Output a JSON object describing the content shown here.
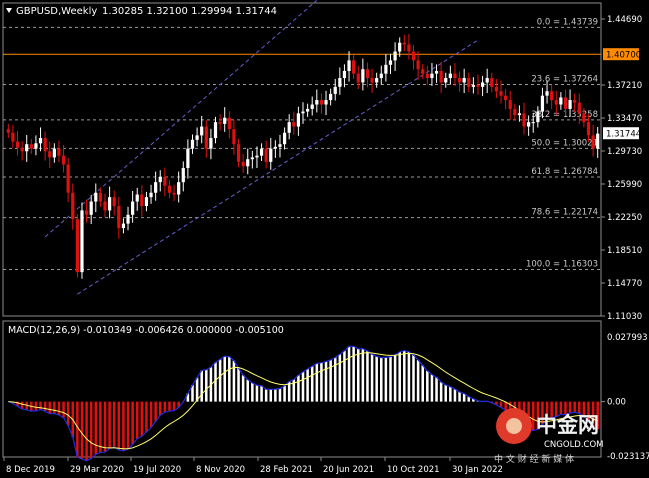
{
  "header": {
    "symbol": "GBPUSD,Weekly",
    "ohlc": "1.30285 1.32100 1.29994 1.31744"
  },
  "colors": {
    "background": "#000000",
    "bull": "#ffffff",
    "bear": "#e01010",
    "grid": "#8c8c8c",
    "fib": "#9a9a9a",
    "resistance": "#ff8c00",
    "channel": "#6a5acd",
    "macd_line": "#1e2ee0",
    "signal_line": "#ffff66",
    "price_tag_bg": "#ffffff"
  },
  "price_axis": {
    "ticks": [
      "1.44690",
      "1.40700",
      "1.37210",
      "1.33470",
      "1.29730",
      "1.25990",
      "1.22250",
      "1.18510",
      "1.14770",
      "1.11030"
    ],
    "current_price": "1.31744",
    "resistance_label": "1.40700"
  },
  "fib_levels": [
    {
      "label": "0.0 = 1.43739",
      "price": 1.43739
    },
    {
      "label": "23.6 = 1.37264",
      "price": 1.37264
    },
    {
      "label": "38.2 = 1.33258",
      "price": 1.33258
    },
    {
      "label": "50.0 = 1.30021",
      "price": 1.30021
    },
    {
      "label": "61.8 = 1.26784",
      "price": 1.26784
    },
    {
      "label": "78.6 = 1.22174",
      "price": 1.22174
    },
    {
      "label": "100.0 = 1.16303",
      "price": 1.16303
    }
  ],
  "resistance_price": 1.407,
  "macd": {
    "label": "MACD(12,26,9) -0.010349 -0.006426 0.000000 -0.005100",
    "axis_ticks": [
      "0.027993",
      "0.00",
      "-0.023137"
    ]
  },
  "time_axis": [
    "8 Dec 2019",
    "29 Mar 2020",
    "19 Jul 2020",
    "8 Nov 2020",
    "28 Feb 2021",
    "20 Jun 2021",
    "10 Oct 2021",
    "30 Jan 2022"
  ],
  "watermark": {
    "name": "中金网",
    "site": "CNGOLD.COM",
    "slogan": "中 文 财 经 新 媒 体"
  },
  "chart_data": {
    "type": "candlestick",
    "timeframe": "Weekly",
    "y_range": [
      1.1103,
      1.4469
    ],
    "closes": [
      1.318,
      1.308,
      1.301,
      1.297,
      1.305,
      1.3,
      1.306,
      1.312,
      1.297,
      1.29,
      1.3,
      1.292,
      1.282,
      1.25,
      1.22,
      1.16,
      1.23,
      1.225,
      1.24,
      1.25,
      1.24,
      1.23,
      1.245,
      1.235,
      1.21,
      1.215,
      1.225,
      1.24,
      1.248,
      1.235,
      1.245,
      1.25,
      1.262,
      1.268,
      1.258,
      1.25,
      1.248,
      1.262,
      1.278,
      1.3,
      1.31,
      1.315,
      1.325,
      1.3,
      1.312,
      1.33,
      1.328,
      1.335,
      1.322,
      1.305,
      1.285,
      1.28,
      1.288,
      1.29,
      1.292,
      1.3,
      1.285,
      1.3,
      1.302,
      1.305,
      1.318,
      1.33,
      1.325,
      1.34,
      1.342,
      1.345,
      1.35,
      1.355,
      1.35,
      1.355,
      1.362,
      1.37,
      1.38,
      1.388,
      1.4,
      1.385,
      1.375,
      1.39,
      1.38,
      1.375,
      1.38,
      1.385,
      1.395,
      1.4,
      1.41,
      1.42,
      1.418,
      1.41,
      1.4,
      1.39,
      1.385,
      1.38,
      1.385,
      1.388,
      1.375,
      1.38,
      1.385,
      1.38,
      1.375,
      1.38,
      1.37,
      1.372,
      1.37,
      1.375,
      1.38,
      1.37,
      1.365,
      1.36,
      1.355,
      1.345,
      1.338,
      1.34,
      1.325,
      1.33,
      1.33,
      1.342,
      1.36,
      1.365,
      1.355,
      1.35,
      1.358,
      1.345,
      1.355,
      1.352,
      1.34,
      1.33,
      1.315,
      1.3,
      1.317
    ]
  }
}
